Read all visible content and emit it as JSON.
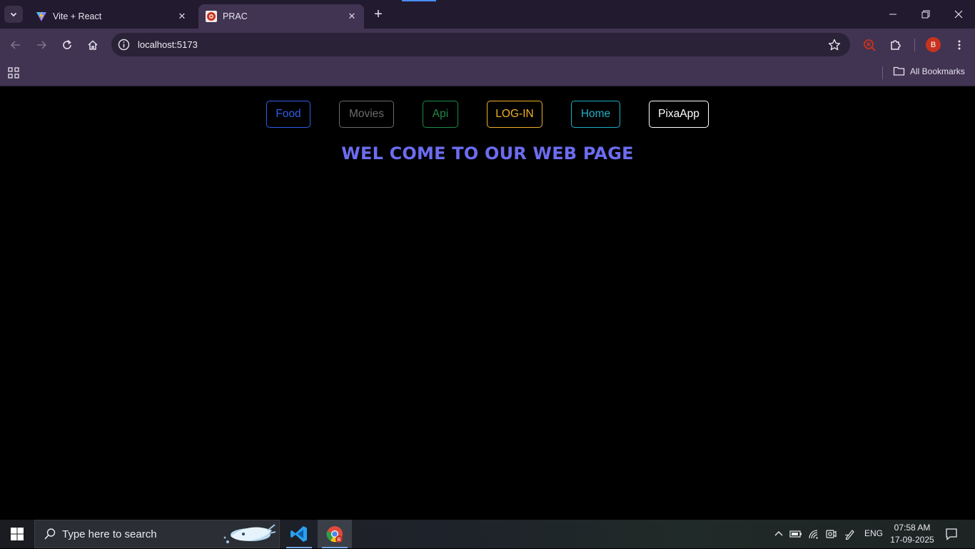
{
  "browser": {
    "tabs": [
      {
        "title": "Vite + React",
        "active": false
      },
      {
        "title": "PRAC",
        "active": true
      }
    ],
    "url": "localhost:5173",
    "profile_initial": "B",
    "bookmarks_label": "All Bookmarks"
  },
  "page": {
    "nav_buttons": [
      {
        "label": "Food",
        "color": "#2f5ee8"
      },
      {
        "label": "Movies",
        "color": "#6b6b6b"
      },
      {
        "label": "Api",
        "color": "#1f8a4c"
      },
      {
        "label": "LOG-IN",
        "color": "#f0b02a"
      },
      {
        "label": "Home",
        "color": "#1fb0c8"
      },
      {
        "label": "PixaApp",
        "color": "#ffffff"
      }
    ],
    "heading": "WEL COME TO OUR WEB PAGE"
  },
  "taskbar": {
    "search_placeholder": "Type here to search",
    "language": "ENG",
    "time": "07:58 AM",
    "date": "17-09-2025"
  },
  "colors": {
    "heading": "#6c6cf0",
    "chrome_toolbar": "#403452",
    "chrome_tabstrip": "#221a2e",
    "page_bg": "#000000"
  }
}
